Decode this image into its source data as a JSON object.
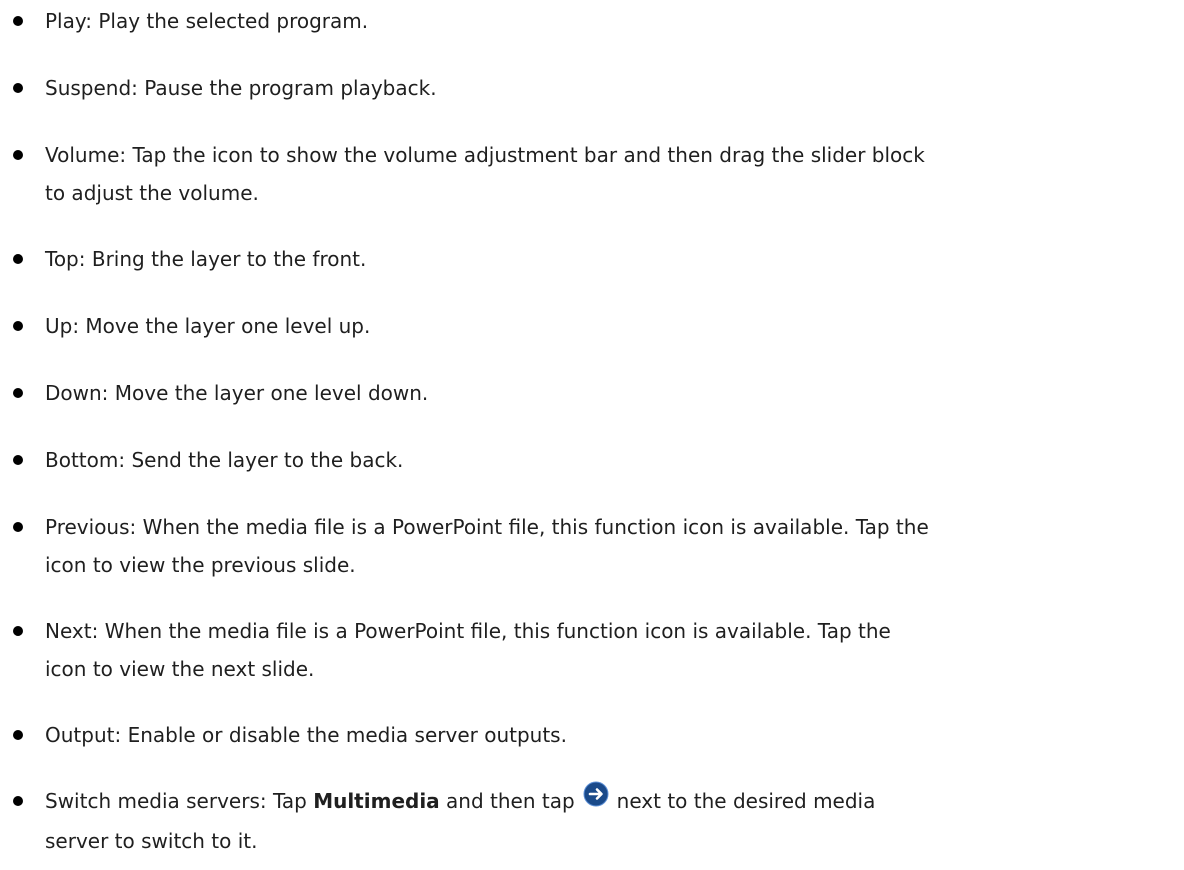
{
  "items": [
    {
      "text": "Play: Play the selected program."
    },
    {
      "text": "Suspend: Pause the program playback."
    },
    {
      "line1": "Volume: Tap the icon to show the volume adjustment bar and then drag the slider block",
      "line2": "to adjust the volume."
    },
    {
      "text": "Top: Bring the layer to the front."
    },
    {
      "text": "Up: Move the layer one level up."
    },
    {
      "text": "Down: Move the layer one level down."
    },
    {
      "text": "Bottom: Send the layer to the back."
    },
    {
      "line1": "Previous: When the media file is a PowerPoint file, this function icon is available. Tap the",
      "line2": "icon to view the previous slide."
    },
    {
      "line1": "Next: When the media file is a PowerPoint file, this function icon is available. Tap the",
      "line2": "icon to view the next slide."
    },
    {
      "text": "Output: Enable or disable the media server outputs."
    },
    {
      "before": "Switch media servers: Tap ",
      "bold": "Multimedia",
      "middle": " and then tap",
      "after": "next to the desired media",
      "line2": "server to switch to it."
    }
  ],
  "icon": {
    "name": "arrow-right-circle-icon",
    "color": "#1a4a8a"
  }
}
